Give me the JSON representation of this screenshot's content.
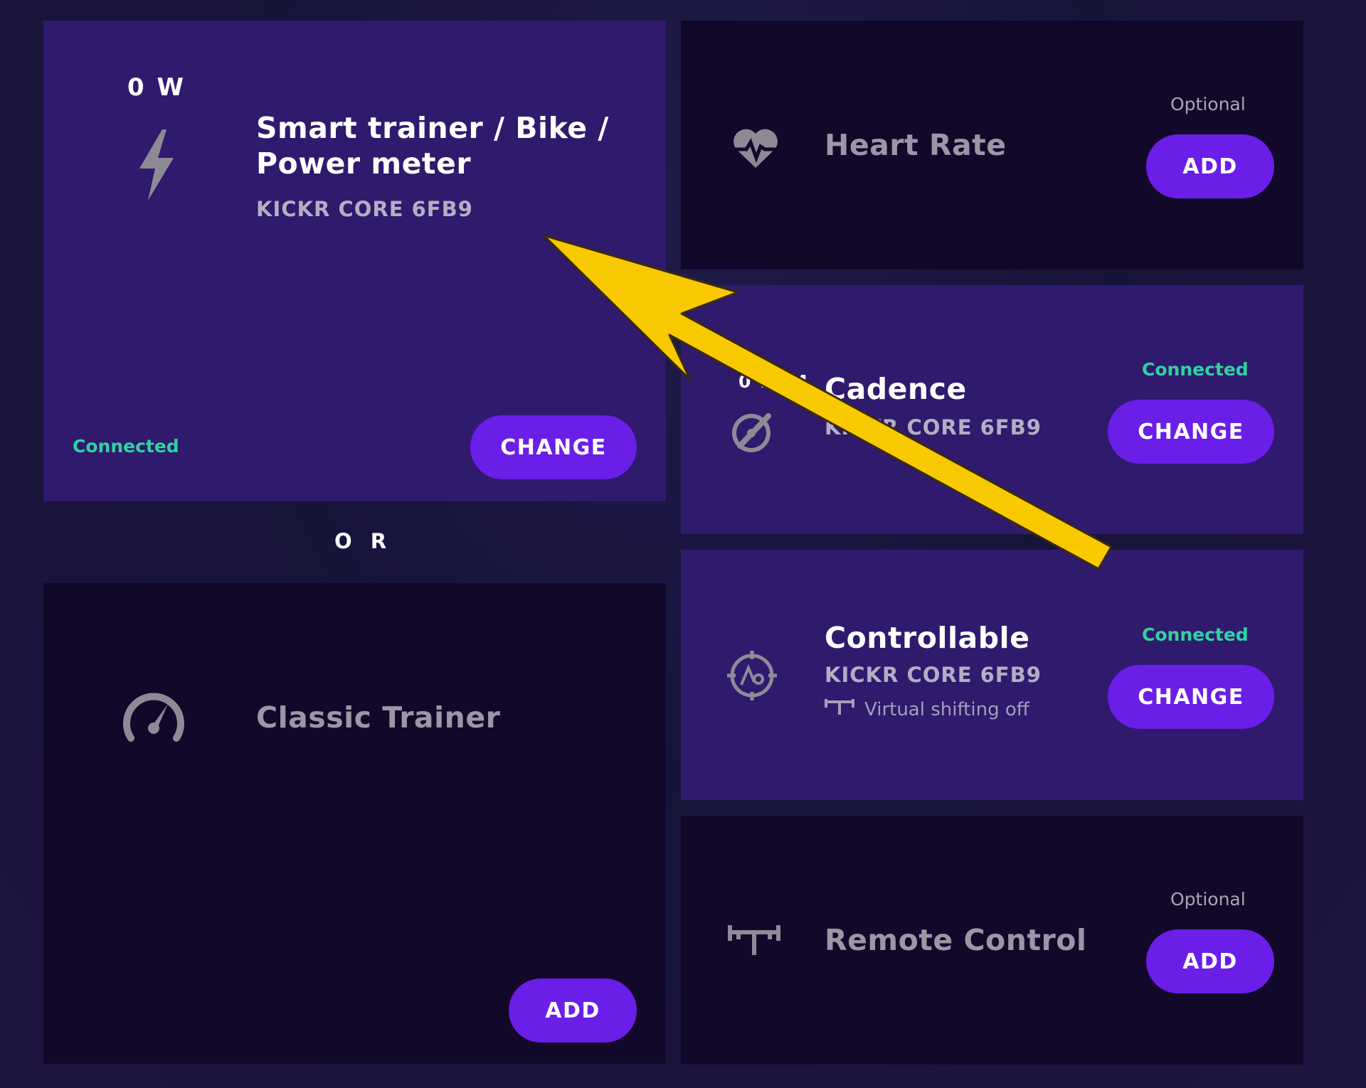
{
  "power_card": {
    "metric": "0 W",
    "icon": "lightning-icon",
    "title_line1": "Smart trainer / Bike /",
    "title_line2": "Power meter",
    "device": "KICKR CORE 6FB9",
    "status": "Connected",
    "button": "CHANGE"
  },
  "or_label": "O R",
  "classic_card": {
    "icon": "speedometer-icon",
    "title": "Classic Trainer",
    "button": "ADD"
  },
  "heart_card": {
    "icon": "heart-rate-icon",
    "title": "Heart Rate",
    "optional": "Optional",
    "button": "ADD"
  },
  "cadence_card": {
    "metric": "0 RPM",
    "icon": "cadence-icon",
    "title": "Cadence",
    "device": "KICKR CORE 6FB9",
    "status": "Connected",
    "button": "CHANGE"
  },
  "controllable_card": {
    "icon": "controllable-target-icon",
    "title": "Controllable",
    "device": "KICKR CORE 6FB9",
    "shifting": "Virtual shifting off",
    "status": "Connected",
    "button": "CHANGE"
  },
  "remote_card": {
    "icon": "handlebar-remote-icon",
    "title": "Remote Control",
    "optional": "Optional",
    "button": "ADD"
  },
  "colors": {
    "active_card": "#2f1a6e",
    "inactive_card": "#12082a",
    "button": "#6a1ee8",
    "connected": "#2fd3a0",
    "arrow": "#f8c800"
  }
}
